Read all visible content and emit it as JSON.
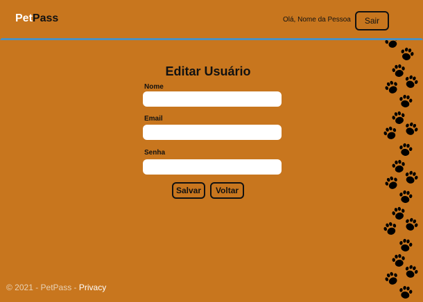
{
  "header": {
    "brand_part1": "Pet",
    "brand_part2": "Pass",
    "greeting": "Olá, Nome da Pessoa",
    "logout_label": "Sair"
  },
  "form": {
    "title": "Editar Usuário",
    "name_label": "Nome",
    "name_value": "",
    "email_label": "Email",
    "email_value": "",
    "password_label": "Senha",
    "password_value": "",
    "save_label": "Salvar",
    "back_label": "Voltar"
  },
  "footer": {
    "copyright": "© 2021 - PetPass - ",
    "privacy_label": "Privacy"
  },
  "decoration": {
    "paw_icon": "paw-print-icon",
    "paw_color": "#000000"
  }
}
